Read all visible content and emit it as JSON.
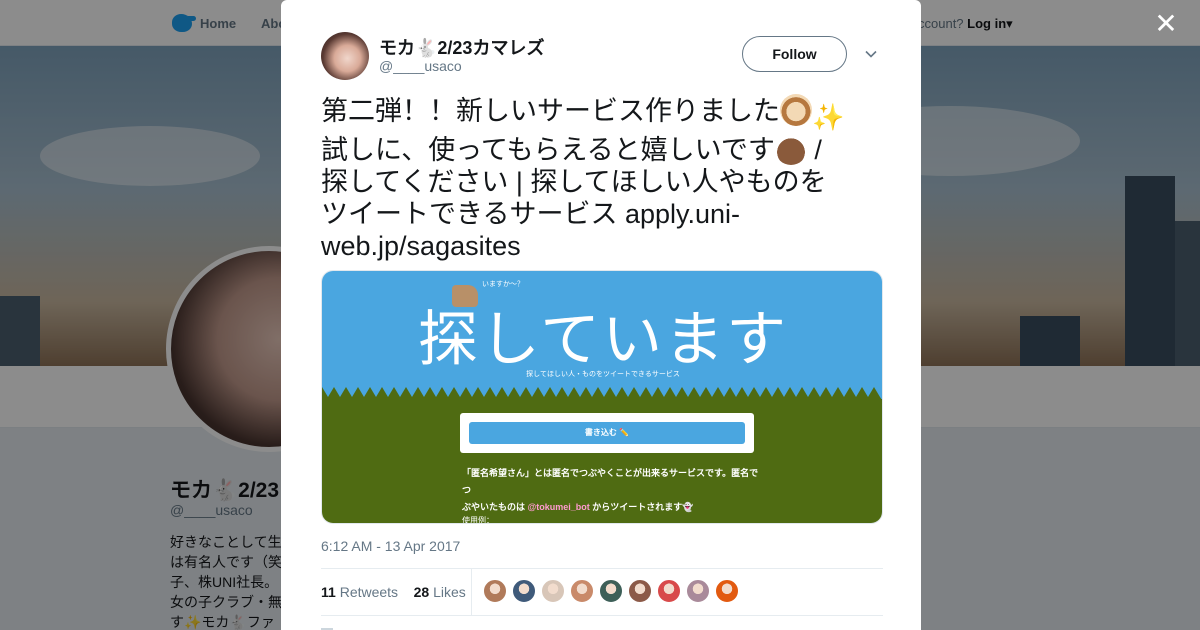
{
  "topbar": {
    "home_label": "Home",
    "about_label": "Abo",
    "account_prompt": "ccount?",
    "login_label": "Log in"
  },
  "profile": {
    "name": "モカ🐇2/23",
    "handle": "@____usaco",
    "bio": "好きなことして生\nは有名人です（笑\n子、株UNI社長。\n女の子クラブ・無\nす✨モカ🐇ファ"
  },
  "tweet": {
    "author_name": "モカ🐇2/23カマレズ",
    "author_handle": "@____usaco",
    "follow_label": "Follow",
    "text_line1": "第二弾！！新しいサービス作りました",
    "text_line2a": "試しに、使ってもらえると嬉しいです",
    "text_line2b": " /",
    "text_line3": "探してください | 探してほしい人やものを",
    "text_line4": "ツイートできるサービス apply.uni-",
    "text_line5": "web.jp/sagasites",
    "timestamp": "6:12 AM - 13 Apr 2017",
    "retweets_count": "11",
    "retweets_label": "Retweets",
    "likes_count": "28",
    "likes_label": "Likes"
  },
  "card": {
    "kicker": "いますか～？",
    "title": "探しています",
    "subtitle": "探してほしい人・ものをツイートできるサービス",
    "button_label": "書き込む ✏️",
    "desc_line1": "「匿名希望さん」とは匿名でつぶやくことが出来るサービスです。匿名でつ",
    "desc_line2_pre": "ぶやいたものは ",
    "desc_mention": "@tokumei_bot",
    "desc_line2_post": " からツイートされます👻",
    "more": "使用例："
  },
  "icons": {
    "close": "close-icon",
    "caret": "chevron-down-icon",
    "brand": "twitter-bird-icon"
  },
  "colors": {
    "brand": "#1da1f2",
    "card_sky": "#4aa6e0",
    "card_grass": "#4f6b12",
    "mention": "#ff9bd0"
  },
  "likers": [
    {
      "color": "#b07a5a"
    },
    {
      "color": "#3f5a7a"
    },
    {
      "color": "#d8c6b8"
    },
    {
      "color": "#c98a6a"
    },
    {
      "color": "#3d5f58"
    },
    {
      "color": "#8c5a48"
    },
    {
      "color": "#d84a4a"
    },
    {
      "color": "#a98a9a"
    },
    {
      "color": "#e25a10"
    }
  ]
}
